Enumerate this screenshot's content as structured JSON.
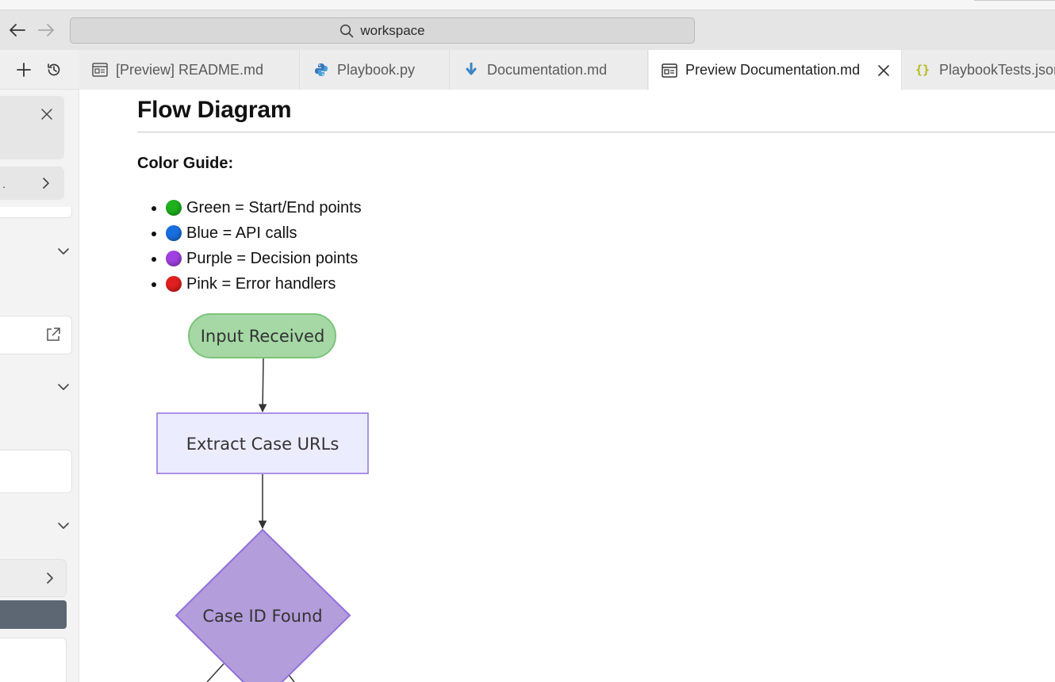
{
  "window": {
    "search_text": "workspace"
  },
  "tabs": [
    {
      "label": "[Preview] README.md",
      "icon": "preview-icon",
      "active": false
    },
    {
      "label": "Playbook.py",
      "icon": "python-icon",
      "active": false
    },
    {
      "label": "Documentation.md",
      "icon": "markdown-icon",
      "active": false
    },
    {
      "label": "Preview Documentation.md",
      "icon": "preview-icon",
      "active": true
    },
    {
      "label": "PlaybookTests.json",
      "icon": "json-icon",
      "active": false
    }
  ],
  "document": {
    "heading": "Flow Diagram",
    "color_guide_label": "Color Guide:",
    "legend": [
      {
        "text": "Green = Start/End points",
        "color": "#1fb01f"
      },
      {
        "text": "Blue = API calls",
        "color": "#1a6fe0"
      },
      {
        "text": "Purple = Decision points",
        "color": "#a040e0"
      },
      {
        "text": "Pink = Error handlers",
        "color": "#e01f1f"
      }
    ]
  },
  "diagram": {
    "nodes": {
      "start": "Input Received",
      "extract": "Extract Case URLs",
      "decision": "Case ID Found"
    },
    "colors": {
      "start_fill": "#a5d8a5",
      "start_stroke": "#7cc47c",
      "process_fill": "#ececff",
      "process_stroke": "#9370db",
      "decision_fill": "#b39ddb",
      "decision_stroke": "#9370db"
    }
  }
}
